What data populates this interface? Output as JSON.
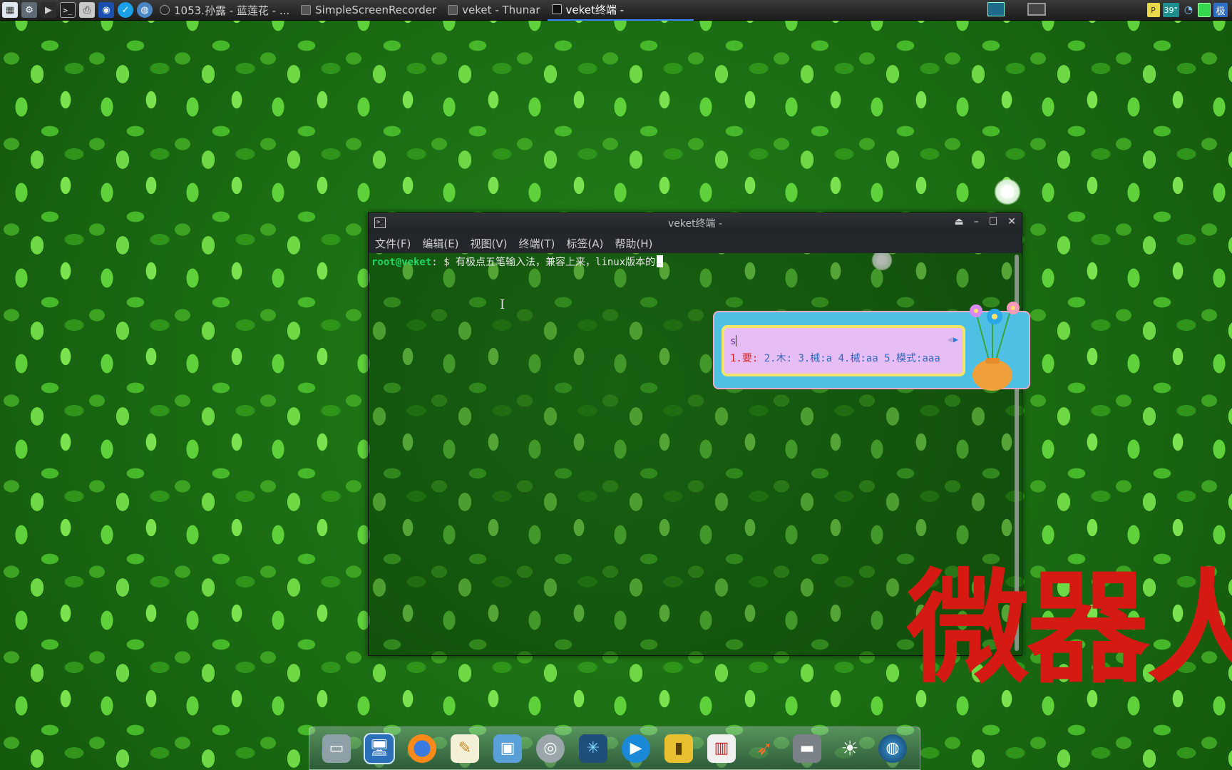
{
  "taskbar": {
    "launchers": [
      "system-monitor-icon",
      "settings-icon",
      "media-player-icon",
      "terminal-icon",
      "printer-icon",
      "screenshot-icon",
      "check-icon",
      "network-icon"
    ],
    "tasks": [
      {
        "label": "1053.孙露 - 蓝莲花 - ...",
        "icon": "music-icon"
      },
      {
        "label": "SimpleScreenRecorder",
        "icon": "recorder-icon"
      },
      {
        "label": "veket - Thunar",
        "icon": "folder-icon"
      },
      {
        "label": "veket终端 -",
        "icon": "terminal-icon",
        "active": true
      }
    ],
    "tray": {
      "p_label": "P",
      "temp": "39°",
      "ime_label": "极"
    }
  },
  "terminal": {
    "title": "veket终端 -",
    "menu": [
      "文件(F)",
      "编辑(E)",
      "视图(V)",
      "终端(T)",
      "标签(A)",
      "帮助(H)"
    ],
    "prompt_user": "root@veket",
    "prompt_sep": ": $",
    "command_text": " 有极点五笔输入法，兼容上来，linux版本的"
  },
  "ime": {
    "input": "s",
    "candidates": [
      {
        "text": "1.要:",
        "highlight": true
      },
      {
        "text": " 2.木: 3.械:a 4.械:aa 5.模式:aaa",
        "highlight": false
      }
    ]
  },
  "overlay": {
    "text": "微器人"
  },
  "dock": {
    "items": [
      "desktop-icon",
      "computer-icon",
      "firefox-icon",
      "text-editor-icon",
      "image-viewer-icon",
      "disk-icon",
      "network-share-icon",
      "media-player-icon",
      "notes-icon",
      "presentation-icon",
      "rocket-icon",
      "drive-icon",
      "brightness-icon",
      "globe-icon"
    ]
  },
  "colors": {
    "prompt_green": "#1ed760",
    "overlay_red": "#d41a12",
    "ime_blue": "#4ec0e4",
    "ime_purple": "#e6bef5"
  }
}
